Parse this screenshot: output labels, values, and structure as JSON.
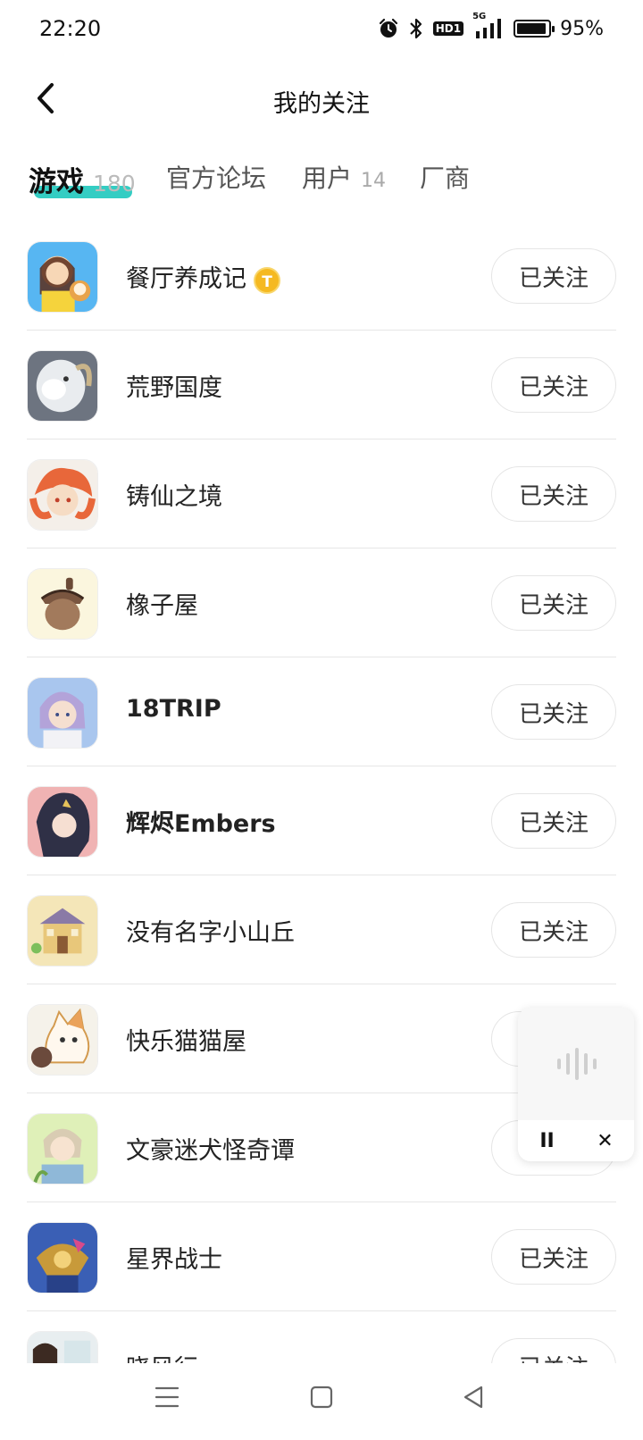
{
  "status": {
    "time": "22:20",
    "hd_label": "HD1",
    "network_label": "5G",
    "battery_percent": "95%",
    "battery_level": 0.95
  },
  "header": {
    "title": "我的关注"
  },
  "tabs": [
    {
      "label": "游戏",
      "count": "180"
    },
    {
      "label": "官方论坛",
      "count": ""
    },
    {
      "label": "用户",
      "count": "14"
    },
    {
      "label": "厂商",
      "count": ""
    }
  ],
  "coin_label": "T",
  "follow_label": "已关注",
  "items": [
    {
      "name": "餐厅养成记"
    },
    {
      "name": "荒野国度"
    },
    {
      "name": "铸仙之境"
    },
    {
      "name": "橡子屋"
    },
    {
      "name": "18TRIP"
    },
    {
      "name": "辉烬Embers"
    },
    {
      "name": "没有名字小山丘"
    },
    {
      "name": "快乐猫猫屋"
    },
    {
      "name": "文豪迷犬怪奇谭"
    },
    {
      "name": "星界战士"
    },
    {
      "name": "晓风行"
    }
  ],
  "voice_widget": {
    "pause_label": "II",
    "close_label": "✕"
  },
  "icons": {
    "back": "chevron-left-icon",
    "alarm": "alarm-icon",
    "bluetooth": "bluetooth-icon",
    "signal": "signal-icon",
    "menu": "menu-icon",
    "home": "home-icon",
    "nav_back": "triangle-back-icon",
    "voice": "voice-wave-icon"
  }
}
